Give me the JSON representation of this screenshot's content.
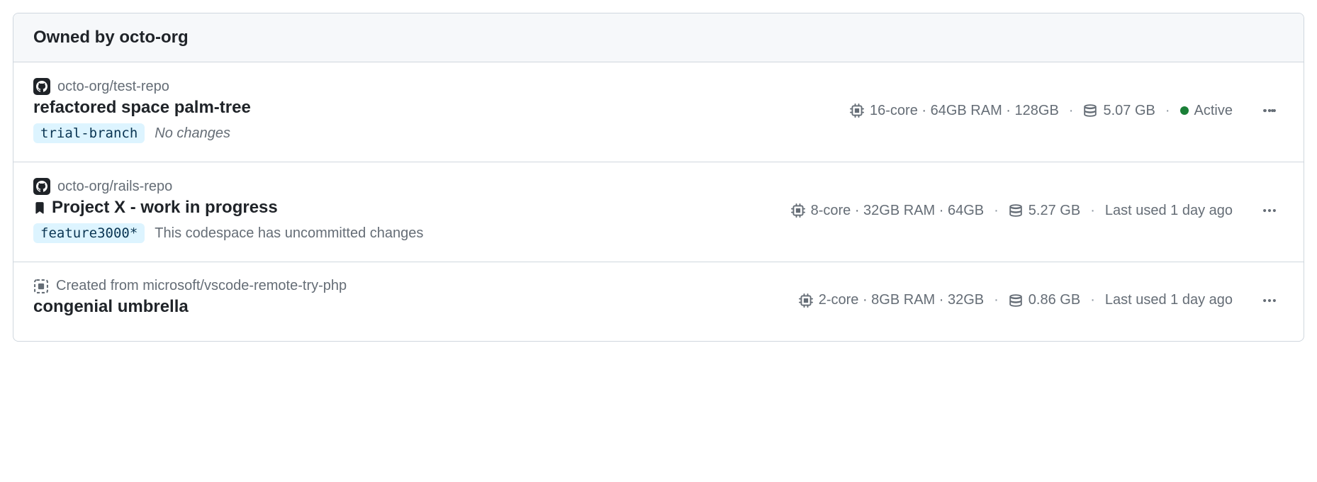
{
  "header": {
    "title": "Owned by octo-org"
  },
  "codespaces": [
    {
      "repo": "octo-org/test-repo",
      "repo_icon": "github",
      "bookmarked": false,
      "name": "refactored space palm-tree",
      "branch": "trial-branch",
      "branch_note": "No changes",
      "branch_note_italic": true,
      "specs": "16-core · 64GB RAM · 128GB",
      "storage": "5.07 GB",
      "status_text": "Active",
      "status_active": true
    },
    {
      "repo": "octo-org/rails-repo",
      "repo_icon": "github",
      "bookmarked": true,
      "name": "Project X - work in progress",
      "branch": "feature3000*",
      "branch_note": "This codespace has uncommitted changes",
      "branch_note_italic": false,
      "specs": "8-core · 32GB RAM · 64GB",
      "storage": "5.27 GB",
      "status_text": "Last used 1 day ago",
      "status_active": false
    },
    {
      "repo": "Created from microsoft/vscode-remote-try-php",
      "repo_icon": "template",
      "bookmarked": false,
      "name": "congenial umbrella",
      "branch": null,
      "branch_note": null,
      "branch_note_italic": false,
      "specs": "2-core · 8GB RAM · 32GB",
      "storage": "0.86 GB",
      "status_text": "Last used 1 day ago",
      "status_active": false
    }
  ]
}
